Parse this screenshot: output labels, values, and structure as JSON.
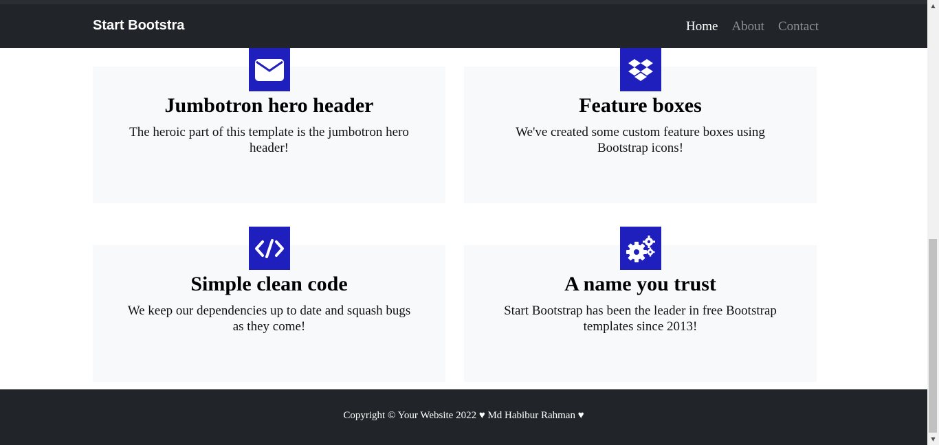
{
  "navbar": {
    "brand": "Start Bootstra",
    "links": [
      {
        "label": "Home",
        "active": true
      },
      {
        "label": "About",
        "active": false
      },
      {
        "label": "Contact",
        "active": false
      }
    ]
  },
  "features": [
    {
      "icon": "envelope-icon",
      "title": "Jumbotron hero header",
      "text": "The heroic part of this template is the jumbotron hero header!"
    },
    {
      "icon": "dropbox-icon",
      "title": "Feature boxes",
      "text": "We've created some custom feature boxes using Bootstrap icons!"
    },
    {
      "icon": "code-icon",
      "title": "Simple clean code",
      "text": "We keep our dependencies up to date and squash bugs as they come!"
    },
    {
      "icon": "gears-icon",
      "title": "A name you trust",
      "text": "Start Bootstrap has been the leader in free Bootstrap templates since 2013!"
    }
  ],
  "footer": {
    "copyright": "Copyright © Your Website 2022 ♥ Md Habibur Rahman ♥"
  },
  "colors": {
    "navbar_bg": "#212529",
    "icon_bg": "#1f1fbd",
    "card_bg": "#f8f9fa"
  }
}
